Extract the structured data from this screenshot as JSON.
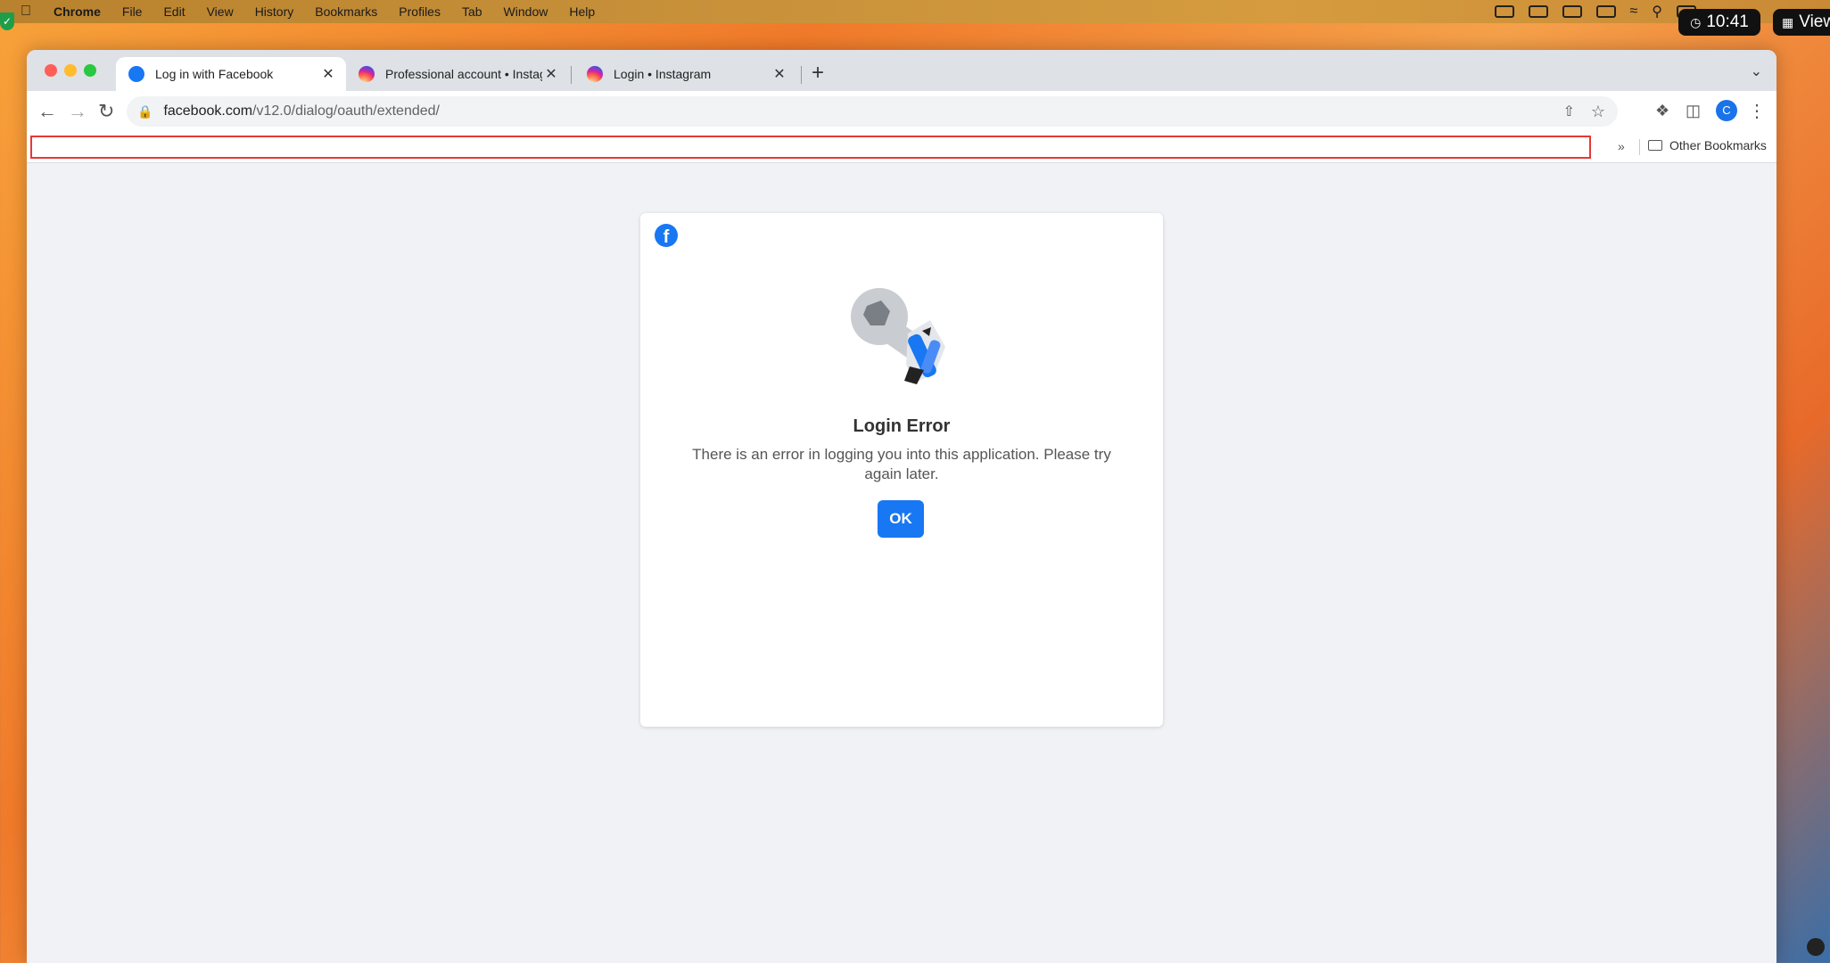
{
  "menubar": {
    "app": "Chrome",
    "items": [
      "File",
      "Edit",
      "View",
      "History",
      "Bookmarks",
      "Profiles",
      "Tab",
      "Window",
      "Help"
    ],
    "clock": "10:41",
    "view_label": "View"
  },
  "tabs": [
    {
      "label": "Log in with Facebook",
      "icon": "facebook-icon",
      "active": true
    },
    {
      "label": "Professional account • Instagram",
      "icon": "instagram-icon",
      "active": false
    },
    {
      "label": "Login • Instagram",
      "icon": "instagram-icon",
      "active": false
    }
  ],
  "address": {
    "host": "facebook.com",
    "path": "/v12.0/dialog/oauth/extended/"
  },
  "profile_initial": "C",
  "bookmarks": {
    "other": "Other Bookmarks"
  },
  "dialog": {
    "title": "Login Error",
    "message": "There is an error in logging you into this application. Please try again later.",
    "ok_label": "OK"
  },
  "colors": {
    "facebook_blue": "#1877f2",
    "highlight_red": "#e53935"
  }
}
